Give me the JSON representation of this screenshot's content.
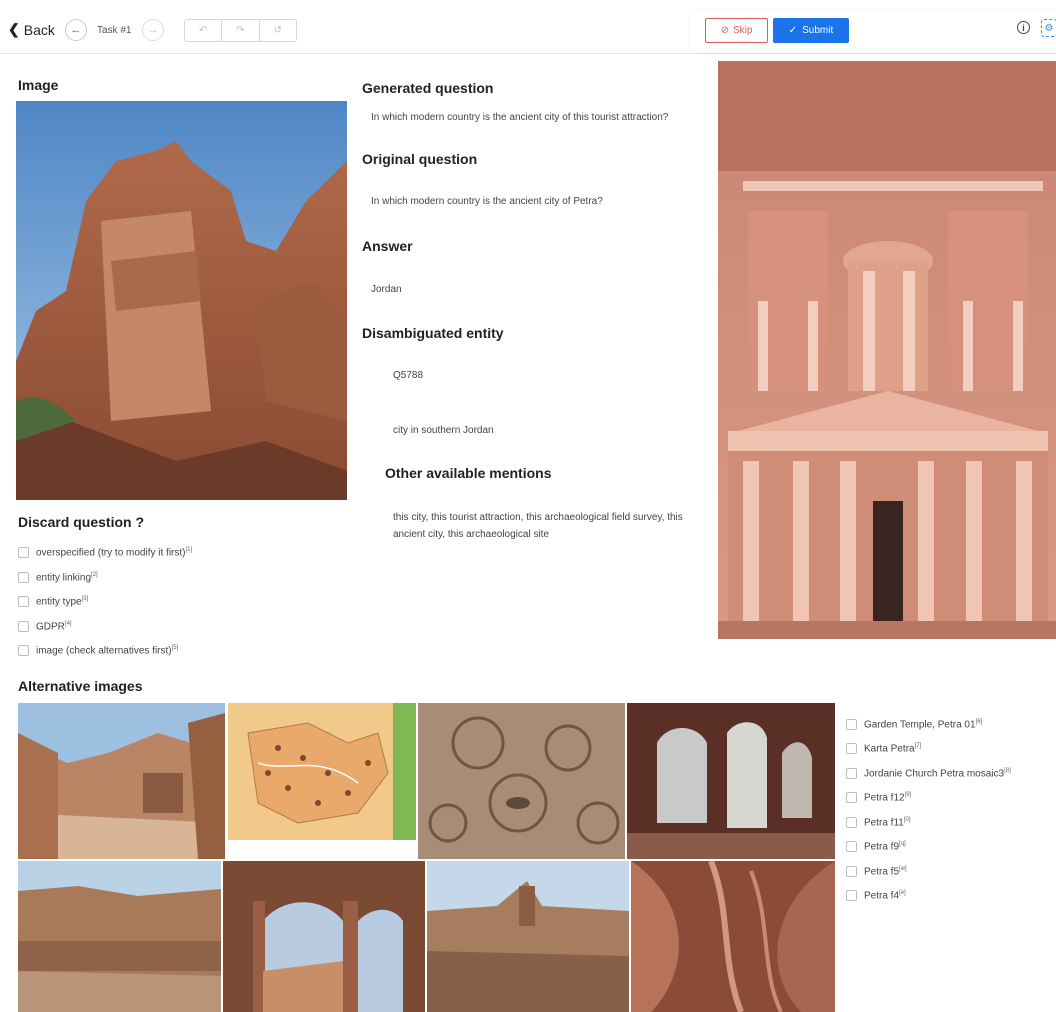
{
  "toolbar": {
    "back_label": "Back",
    "task_label": "Task #1",
    "skip_label": "Skip",
    "submit_label": "Submit"
  },
  "main": {
    "image_heading": "Image",
    "generated_heading": "Generated question",
    "generated_text": "In which modern country is the ancient city of this tourist attraction?",
    "original_heading": "Original question",
    "original_text": "In which modern country is the ancient city of Petra?",
    "answer_heading": "Answer",
    "answer_text": "Jordan",
    "entity_heading": "Disambiguated entity",
    "entity_id": "Q5788",
    "entity_desc": "city in southern Jordan",
    "mentions_heading": "Other available mentions",
    "mentions_text": "this city, this tourist attraction, this archaeological field survey, this ancient city, this archaeological site"
  },
  "discard": {
    "heading": "Discard question ?",
    "options": [
      {
        "label": "overspecified (try to modify it first)",
        "key": "[1]"
      },
      {
        "label": "entity linking",
        "key": "[2]"
      },
      {
        "label": "entity type",
        "key": "[3]"
      },
      {
        "label": "GDPR",
        "key": "[4]"
      },
      {
        "label": "image (check alternatives first)",
        "key": "[5]"
      }
    ]
  },
  "alternatives": {
    "heading": "Alternative images",
    "options": [
      {
        "label": "Garden Temple, Petra 01",
        "key": "[6]"
      },
      {
        "label": "Karta Petra",
        "key": "[7]"
      },
      {
        "label": "Jordanie Church Petra mosaic3",
        "key": "[8]"
      },
      {
        "label": "Petra f12",
        "key": "[9]"
      },
      {
        "label": "Petra f11",
        "key": "[0]"
      },
      {
        "label": "Petra f9",
        "key": "[q]"
      },
      {
        "label": "Petra f5",
        "key": "[w]"
      },
      {
        "label": "Petra f4",
        "key": "[e]"
      }
    ]
  },
  "colors": {
    "accent": "#1a73e8",
    "danger": "#e05b5b"
  }
}
